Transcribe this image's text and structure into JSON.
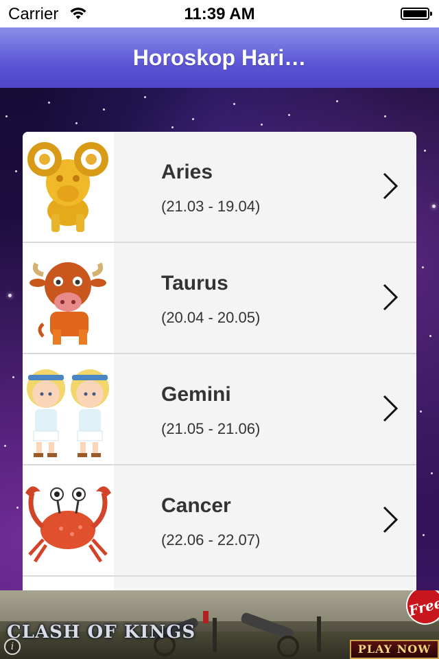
{
  "status_bar": {
    "carrier": "Carrier",
    "time": "11:39 AM",
    "icons": [
      "wifi-icon",
      "battery-icon"
    ]
  },
  "nav_bar": {
    "title": "Horoskop Hari…"
  },
  "signs": [
    {
      "name": "Aries",
      "dates": "(21.03 - 19.04)",
      "icon": "aries-ram-icon"
    },
    {
      "name": "Taurus",
      "dates": "(20.04 - 20.05)",
      "icon": "taurus-bull-icon"
    },
    {
      "name": "Gemini",
      "dates": "(21.05 - 21.06)",
      "icon": "gemini-twins-icon"
    },
    {
      "name": "Cancer",
      "dates": "(22.06 - 22.07)",
      "icon": "cancer-crab-icon"
    }
  ],
  "ad": {
    "brand": "CLASH OF KINGS",
    "badge": "Free",
    "cta": "PLAY NOW",
    "info": "i"
  },
  "colors": {
    "nav_top": "#8a8fe8",
    "nav_bottom": "#4f45c8",
    "row_background": "#f4f4f4",
    "text": "#333333"
  }
}
